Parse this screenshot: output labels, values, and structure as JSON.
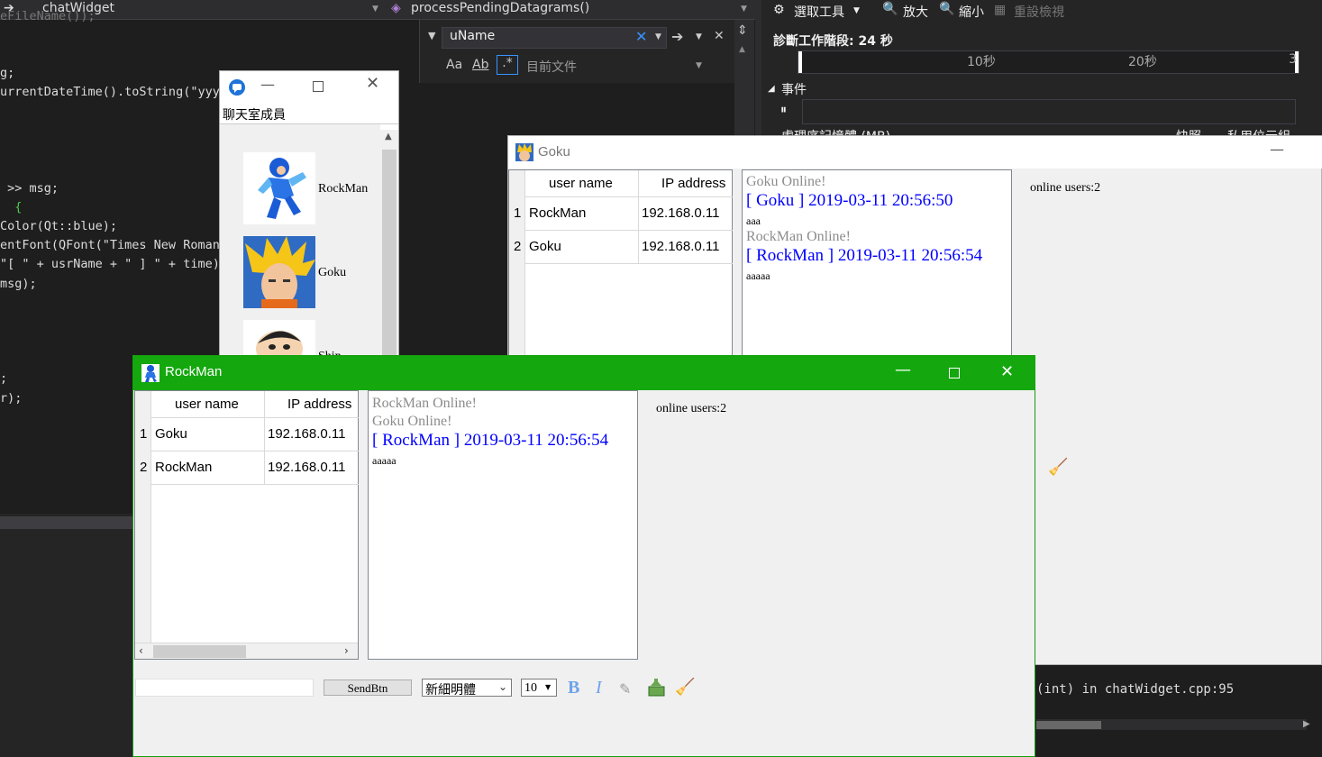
{
  "ide": {
    "class_dropdown": "chatWidget",
    "func_dropdown": "processPendingDatagrams()",
    "find": {
      "query": "uName",
      "scope": "目前文件",
      "opt_case": "Aa",
      "opt_word": "Ab",
      "opt_regex": ".*"
    },
    "code_lines": [
      "eFileName());",
      "g;",
      "urrentDateTime().toString(\"yyy",
      " >> msg;",
      "  {",
      "Color(Qt::blue);",
      "entFont(QFont(\"Times New Roman",
      "\"[ \" + usrName + \" ] \" + time)",
      "msg);",
      ";",
      "r);"
    ],
    "output_line": "(int) in chatWidget.cpp:95"
  },
  "diagnostics": {
    "toolbar": {
      "select_tool": "選取工具",
      "zoom_in": "放大",
      "zoom_out": "縮小",
      "reset_view": "重設檢視"
    },
    "session_label": "診斷工作階段: 24 秒",
    "ticks": [
      "10秒",
      "20秒",
      "3"
    ],
    "events_label": "事件",
    "memory_label": "處理序記憶體 (MB)",
    "snapshot_label": "快照",
    "private_bytes_label": "私用位元組"
  },
  "member_window": {
    "header": "聊天室成員",
    "members": [
      {
        "name": "RockMan"
      },
      {
        "name": "Goku"
      },
      {
        "name": "Shin"
      }
    ]
  },
  "goku_window": {
    "title": "Goku",
    "table": {
      "col_user": "user name",
      "col_ip": "IP address",
      "rows": [
        {
          "num": "1",
          "user": "RockMan",
          "ip": "192.168.0.11"
        },
        {
          "num": "2",
          "user": "Goku",
          "ip": "192.168.0.11"
        }
      ]
    },
    "chat": [
      {
        "kind": "sys",
        "text": "Goku Online!"
      },
      {
        "kind": "stamp",
        "text": "[ Goku ] 2019-03-11 20:56:50"
      },
      {
        "kind": "msg",
        "text": "aaa"
      },
      {
        "kind": "sys",
        "text": "RockMan Online!"
      },
      {
        "kind": "stamp",
        "text": "[ RockMan ] 2019-03-11 20:56:54"
      },
      {
        "kind": "msg",
        "text": "aaaaa"
      }
    ],
    "online": "online users:2"
  },
  "rock_window": {
    "title": "RockMan",
    "table": {
      "col_user": "user name",
      "col_ip": "IP address",
      "rows": [
        {
          "num": "1",
          "user": "Goku",
          "ip": "192.168.0.11"
        },
        {
          "num": "2",
          "user": "RockMan",
          "ip": "192.168.0.11"
        }
      ]
    },
    "chat": [
      {
        "kind": "sys",
        "text": "RockMan Online!"
      },
      {
        "kind": "sys",
        "text": "Goku Online!"
      },
      {
        "kind": "stamp",
        "text": "[ RockMan ] 2019-03-11 20:56:54"
      },
      {
        "kind": "msg",
        "text": "aaaaa"
      }
    ],
    "online": "online users:2",
    "input_value": "",
    "send_label": "SendBtn",
    "font_select": "新細明體",
    "size_select": "10"
  },
  "colors": {
    "accent_green": "#14a80e",
    "timestamp_blue": "#0000ff",
    "system_gray": "#8c8c8c"
  }
}
